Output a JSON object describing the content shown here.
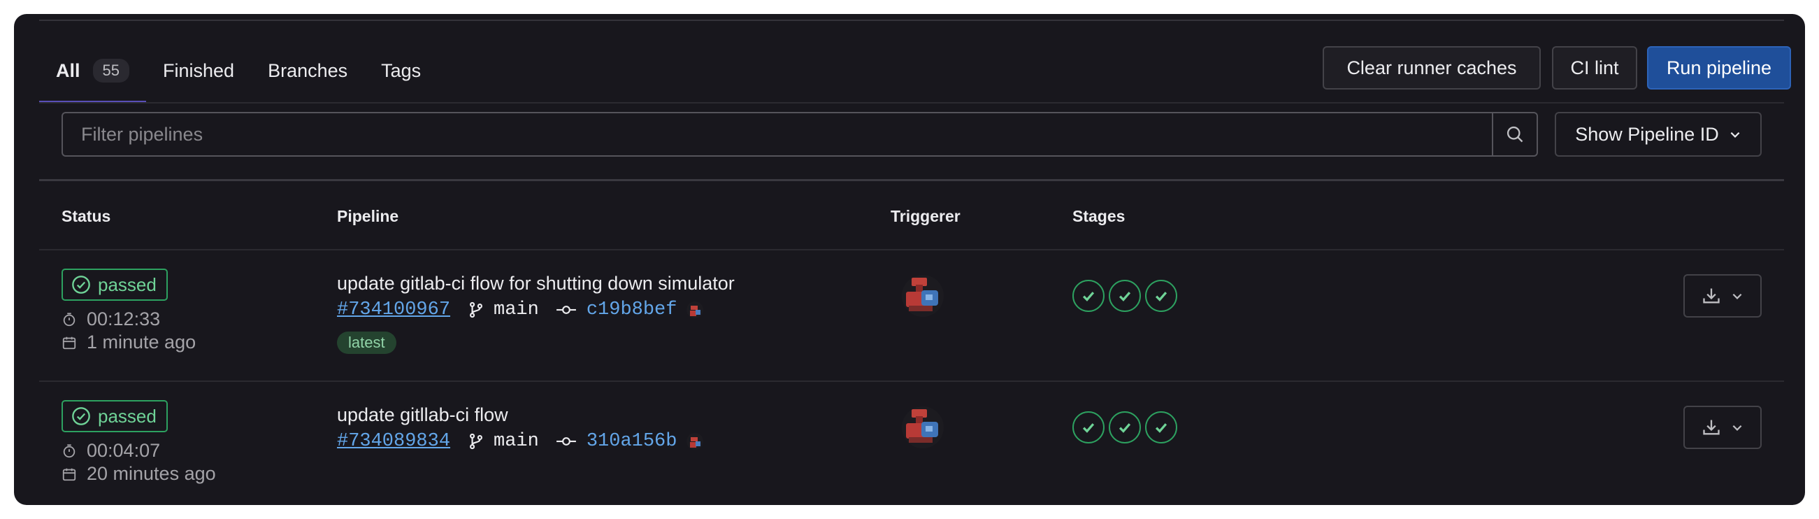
{
  "tabs": [
    {
      "label": "All",
      "count": "55"
    },
    {
      "label": "Finished"
    },
    {
      "label": "Branches"
    },
    {
      "label": "Tags"
    }
  ],
  "actions": {
    "clear_caches": "Clear runner caches",
    "ci_lint": "CI lint",
    "run_pipeline": "Run pipeline"
  },
  "filter": {
    "placeholder": "Filter pipelines",
    "show_id_label": "Show Pipeline ID"
  },
  "columns": {
    "status": "Status",
    "pipeline": "Pipeline",
    "triggerer": "Triggerer",
    "stages": "Stages"
  },
  "pipelines": [
    {
      "status": "passed",
      "duration": "00:12:33",
      "finished": "1 minute ago",
      "title": "update gitlab-ci flow for shutting down simulator",
      "id": "#734100967",
      "ref": "main",
      "sha": "c19b8bef",
      "badge": "latest",
      "stages": [
        "passed",
        "passed",
        "passed"
      ]
    },
    {
      "status": "passed",
      "duration": "00:04:07",
      "finished": "20 minutes ago",
      "title": "update gitllab-ci flow",
      "id": "#734089834",
      "ref": "main",
      "sha": "310a156b",
      "stages": [
        "passed",
        "passed",
        "passed"
      ]
    }
  ],
  "colors": {
    "background": "#18171d",
    "success": "#2da160",
    "link": "#63a6e9",
    "primary_button": "#1f4f9a",
    "active_tab_underline": "#5a4fb8"
  }
}
